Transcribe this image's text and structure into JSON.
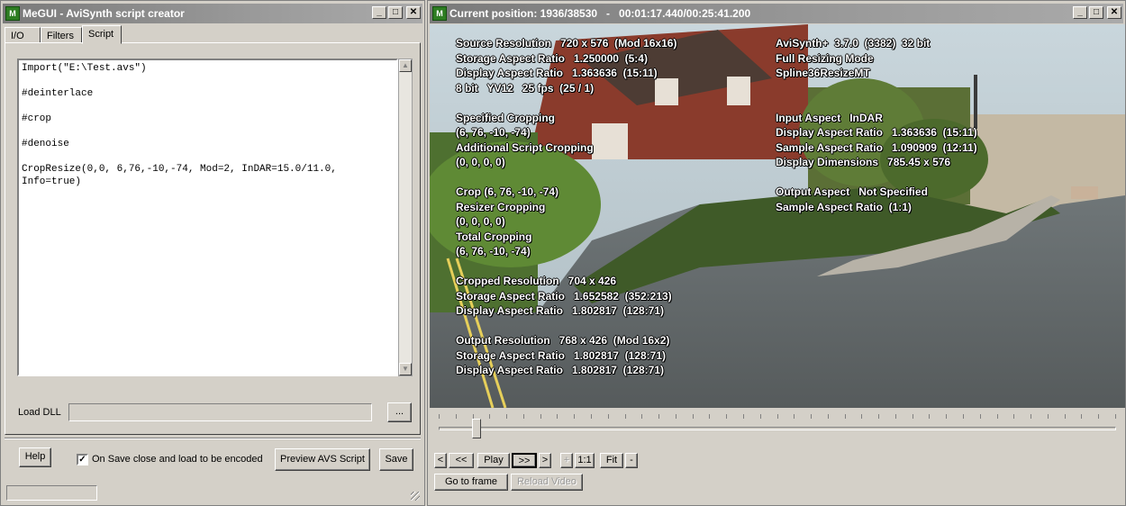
{
  "left_window": {
    "title": "MeGUI - AviSynth script creator",
    "icon_text": "M",
    "tabs": [
      {
        "label": "I/O"
      },
      {
        "label": "Filters"
      },
      {
        "label": "Script"
      }
    ],
    "script_text": "Import(\"E:\\Test.avs\")\n\n#deinterlace\n\n#crop\n\n#denoise\n\nCropResize(0,0, 6,76,-10,-74, Mod=2, InDAR=15.0/11.0,\nInfo=true)",
    "load_dll_label": "Load DLL",
    "load_dll_value": "",
    "browse_label": "...",
    "help_label": "Help",
    "checkbox_label": "On Save close and load to be encoded",
    "checkbox_checked": true,
    "checkbox_mark": "✓",
    "preview_label": "Preview AVS Script",
    "save_label": "Save",
    "status_text": ""
  },
  "right_window": {
    "title": "Current position: 1936/38530   -   00:01:17.440/00:25:41.200",
    "icon_text": "M",
    "overlay_left": "Source Resolution   720 x 576  (Mod 16x16)\nStorage Aspect Ratio   1.250000  (5:4)\nDisplay Aspect Ratio   1.363636  (15:11)\n8 bit   YV12   25 fps  (25 / 1)\n\nSpecified Cropping\n(6, 76, -10, -74)\nAdditional Script Cropping\n(0, 0, 0, 0)\n\nCrop (6, 76, -10, -74)\nResizer Cropping\n(0, 0, 0, 0)\nTotal Cropping\n(6, 76, -10, -74)\n\nCropped Resolution   704 x 426\nStorage Aspect Ratio   1.652582  (352:213)\nDisplay Aspect Ratio   1.802817  (128:71)\n\nOutput Resolution   768 x 426  (Mod 16x2)\nStorage Aspect Ratio   1.802817  (128:71)\nDisplay Aspect Ratio   1.802817  (128:71)",
    "overlay_right": "AviSynth+  3.7.0  (3382)  32 bit\nFull Resizing Mode\nSpline36ResizeMT\n\n\nInput Aspect   InDAR\nDisplay Aspect Ratio   1.363636  (15:11)\nSample Aspect Ratio   1.090909  (12:11)\nDisplay Dimensions   785.45 x 576\n\nOutput Aspect   Not Specified\nSample Aspect Ratio  (1:1)",
    "position_fraction": 0.0502,
    "buttons": {
      "first": "<",
      "back": "<<",
      "play": "Play",
      "forward": ">>",
      "last": ">",
      "zoom_in": "+",
      "zoom_1_1": "1:1",
      "fit": "Fit",
      "zoom_out": "-",
      "goto": "Go to frame",
      "reload": "Reload Video"
    }
  },
  "window_controls": {
    "minimize": "_",
    "maximize": "□",
    "close": "✕"
  },
  "colors": {
    "titlebar_inactive": "#8a8a8a",
    "face": "#d4d0c8",
    "overlay_text": "#ffffff"
  }
}
